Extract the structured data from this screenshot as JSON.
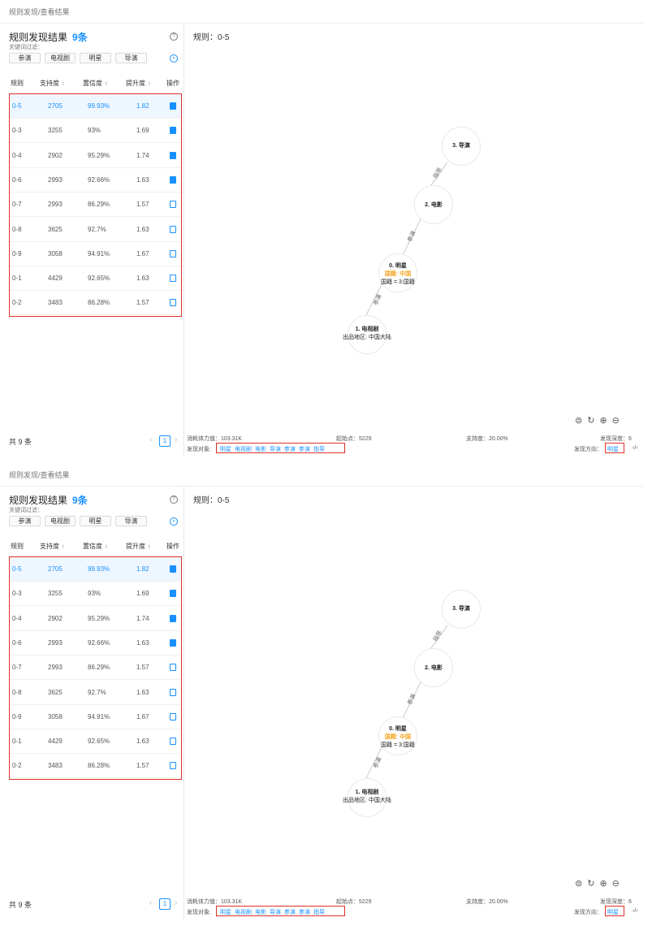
{
  "breadcrumb": "规则发现/查看结果",
  "left": {
    "title": "规则发现结果",
    "count": "9条",
    "keyword_label": "关键词过滤：",
    "tags": [
      "参演",
      "电视剧",
      "明星",
      "导演"
    ],
    "columns": [
      "规则",
      "支持度",
      "置信度",
      "提升度",
      "操作"
    ],
    "rows": [
      {
        "rule": "0-5",
        "support": "2705",
        "confidence": "99.93%",
        "lift": "1.82"
      },
      {
        "rule": "0-3",
        "support": "3255",
        "confidence": "93%",
        "lift": "1.69"
      },
      {
        "rule": "0-4",
        "support": "2902",
        "confidence": "95.29%",
        "lift": "1.74"
      },
      {
        "rule": "0-6",
        "support": "2993",
        "confidence": "92.66%",
        "lift": "1.63"
      },
      {
        "rule": "0-7",
        "support": "2993",
        "confidence": "86.29%",
        "lift": "1.57"
      },
      {
        "rule": "0-8",
        "support": "3625",
        "confidence": "92.7%",
        "lift": "1.63"
      },
      {
        "rule": "0-9",
        "support": "3058",
        "confidence": "94.91%",
        "lift": "1.67"
      },
      {
        "rule": "0-1",
        "support": "4429",
        "confidence": "92.65%",
        "lift": "1.63"
      },
      {
        "rule": "0-2",
        "support": "3483",
        "confidence": "86.28%",
        "lift": "1.57"
      }
    ],
    "total": "共 9 条",
    "page": "1"
  },
  "right": {
    "rule_title": "规则：0-5",
    "nodes": {
      "director": "3. 导演",
      "movie": "2. 电影",
      "star": "0. 明星",
      "star_attr1": "国籍: 中国",
      "star_attr2": "国籍 = 3:国籍",
      "tv": "1. 电视剧",
      "tv_attr": "出品地区: 中国大陆"
    },
    "edges": {
      "e1": "指导",
      "e2": "参演",
      "e3": "参演"
    }
  },
  "footer": {
    "cost": "消耗体力值：103.31K",
    "start": "起始点：5229",
    "support": "支持度：20.00%",
    "depth": "发现深度：6",
    "objects_label": "发现对象:",
    "objects": [
      "明星",
      "电视剧",
      "电影",
      "导演",
      "参演",
      "参演",
      "指导"
    ],
    "direction_label": "发现方向：",
    "direction": "明星"
  }
}
